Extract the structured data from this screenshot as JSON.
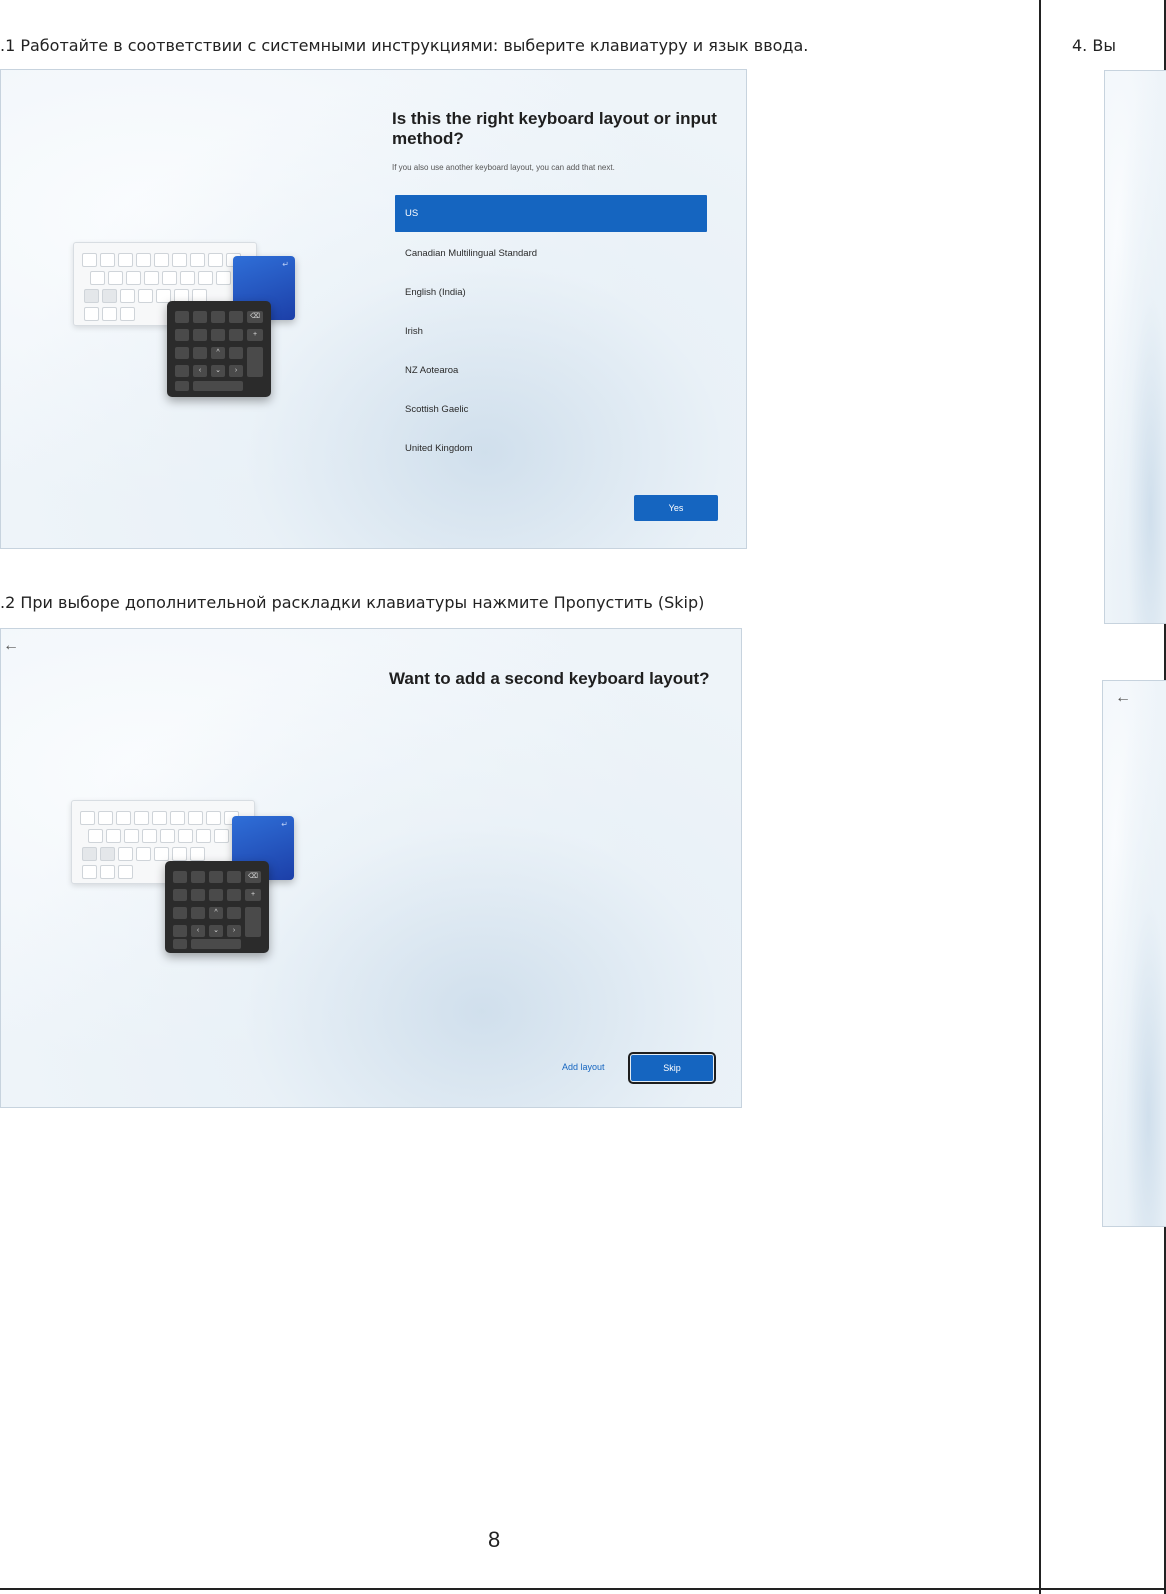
{
  "left_page": {
    "step_3_1_caption": ".1 Работайте в соответствии с системными инструкциями: выберите клавиатуру и язык ввода.",
    "step_3_2_caption": ".2 При выборе дополнительной раскладки клавиатуры  нажмите  Пропустить  (Skip)",
    "page_number": "8"
  },
  "keyboard_screen": {
    "title": "Is this the right keyboard layout or input method?",
    "subtitle": "If you also use another keyboard layout, you can add that next.",
    "layouts": [
      "US",
      "Canadian Multilingual Standard",
      "English (India)",
      "Irish",
      "NZ Aotearoa",
      "Scottish Gaelic",
      "United Kingdom"
    ],
    "selected_layout": "US",
    "yes_button": "Yes"
  },
  "second_layout_screen": {
    "back_icon": "←",
    "title": "Want to add a second keyboard layout?",
    "add_layout_label": "Add layout",
    "skip_button": "Skip"
  },
  "right_page": {
    "step_4_caption": "4. Вы",
    "back_icon": "←"
  },
  "illustration_keys": {
    "enter": "↵",
    "backspace": "⌫",
    "plus": "+",
    "up": "^",
    "left": "‹",
    "down": "⌄",
    "right": "›"
  }
}
